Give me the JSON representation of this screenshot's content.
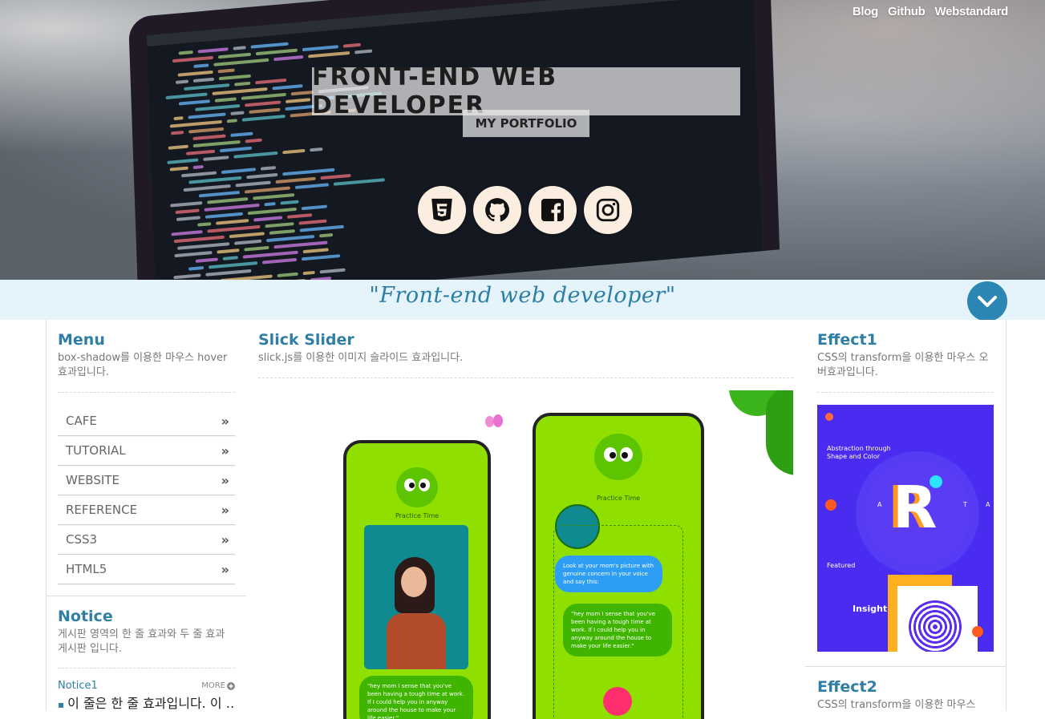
{
  "header": {
    "links": [
      "Blog",
      "Github",
      "Webstandard"
    ],
    "title": "FRONT-END WEB DEVELOPER",
    "subtitle": "MY PORTFOLIO",
    "socials": [
      {
        "name": "html5-icon"
      },
      {
        "name": "github-icon"
      },
      {
        "name": "facebook-icon"
      },
      {
        "name": "instagram-icon"
      }
    ]
  },
  "banner": {
    "quote": "\"Front-end web developer\""
  },
  "menu": {
    "title": "Menu",
    "desc": "box-shadow를 이용한 마우스 hover 효과입니다.",
    "items": [
      "CAFE",
      "TUTORIAL",
      "WEBSITE",
      "REFERENCE",
      "CSS3",
      "HTML5"
    ],
    "chevron": "»"
  },
  "notice": {
    "title": "Notice",
    "desc": "게시판 영역의 한 줄 효과와 두 줄 효과 게시판 입니다.",
    "tab": "Notice1",
    "more": "MORE",
    "first_line": "이 줄은 한 줄 효과입니다. 이 …"
  },
  "slider": {
    "title": "Slick Slider",
    "desc": "slick.js를 이용한 이미지 슬라이드 효과입니다.",
    "phone_label": "Practice Time",
    "bubble1": "Look at your mom's picture with genuine concern in your voice and say this:",
    "bubble2": "\"hey mom I sense that you've been having a tough time at work. If I could help you in anyway around the house to make your life easier.\"",
    "bubble3": "\"hey mom I sense that you've been having a tough time at work. If I could help you in anyway around the house to make your life easier.\""
  },
  "effect1": {
    "title": "Effect1",
    "desc": "CSS의 transform을 이용한 마우스 오버효과입니다.",
    "card_heading": "Abstraction through Shape and Color",
    "card_featured": "Featured",
    "card_insight": "Insight",
    "card_letters": [
      "A",
      "T",
      "A"
    ]
  },
  "effect2": {
    "title": "Effect2",
    "desc": "CSS의 transform을 이용한 마우스"
  },
  "colors": {
    "accent": "#2f7ea3",
    "banner_bg": "#e5f3fa",
    "scroll_button": "#2b86b3"
  }
}
